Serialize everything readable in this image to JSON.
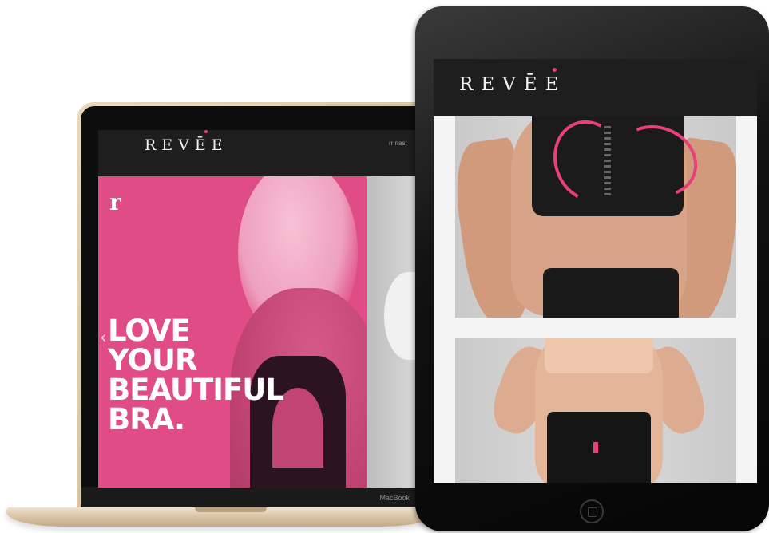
{
  "brand": {
    "logo_text": "REVĒE",
    "accent_color": "#e04c85"
  },
  "laptop": {
    "model_label": "MacBook",
    "nav_text": "rr nast",
    "hero": {
      "monogram": "r",
      "headline": [
        "LOVE",
        "YOUR",
        "BEAUTIFUL",
        "BRA."
      ],
      "prev_arrow_icon": "chevron-left-icon"
    }
  },
  "tablet": {
    "camera_icon": "camera-icon",
    "home_button_icon": "home-button-icon",
    "photos": [
      "photo-front-closure-bra",
      "photo-nude-bra-compression-pants"
    ]
  }
}
